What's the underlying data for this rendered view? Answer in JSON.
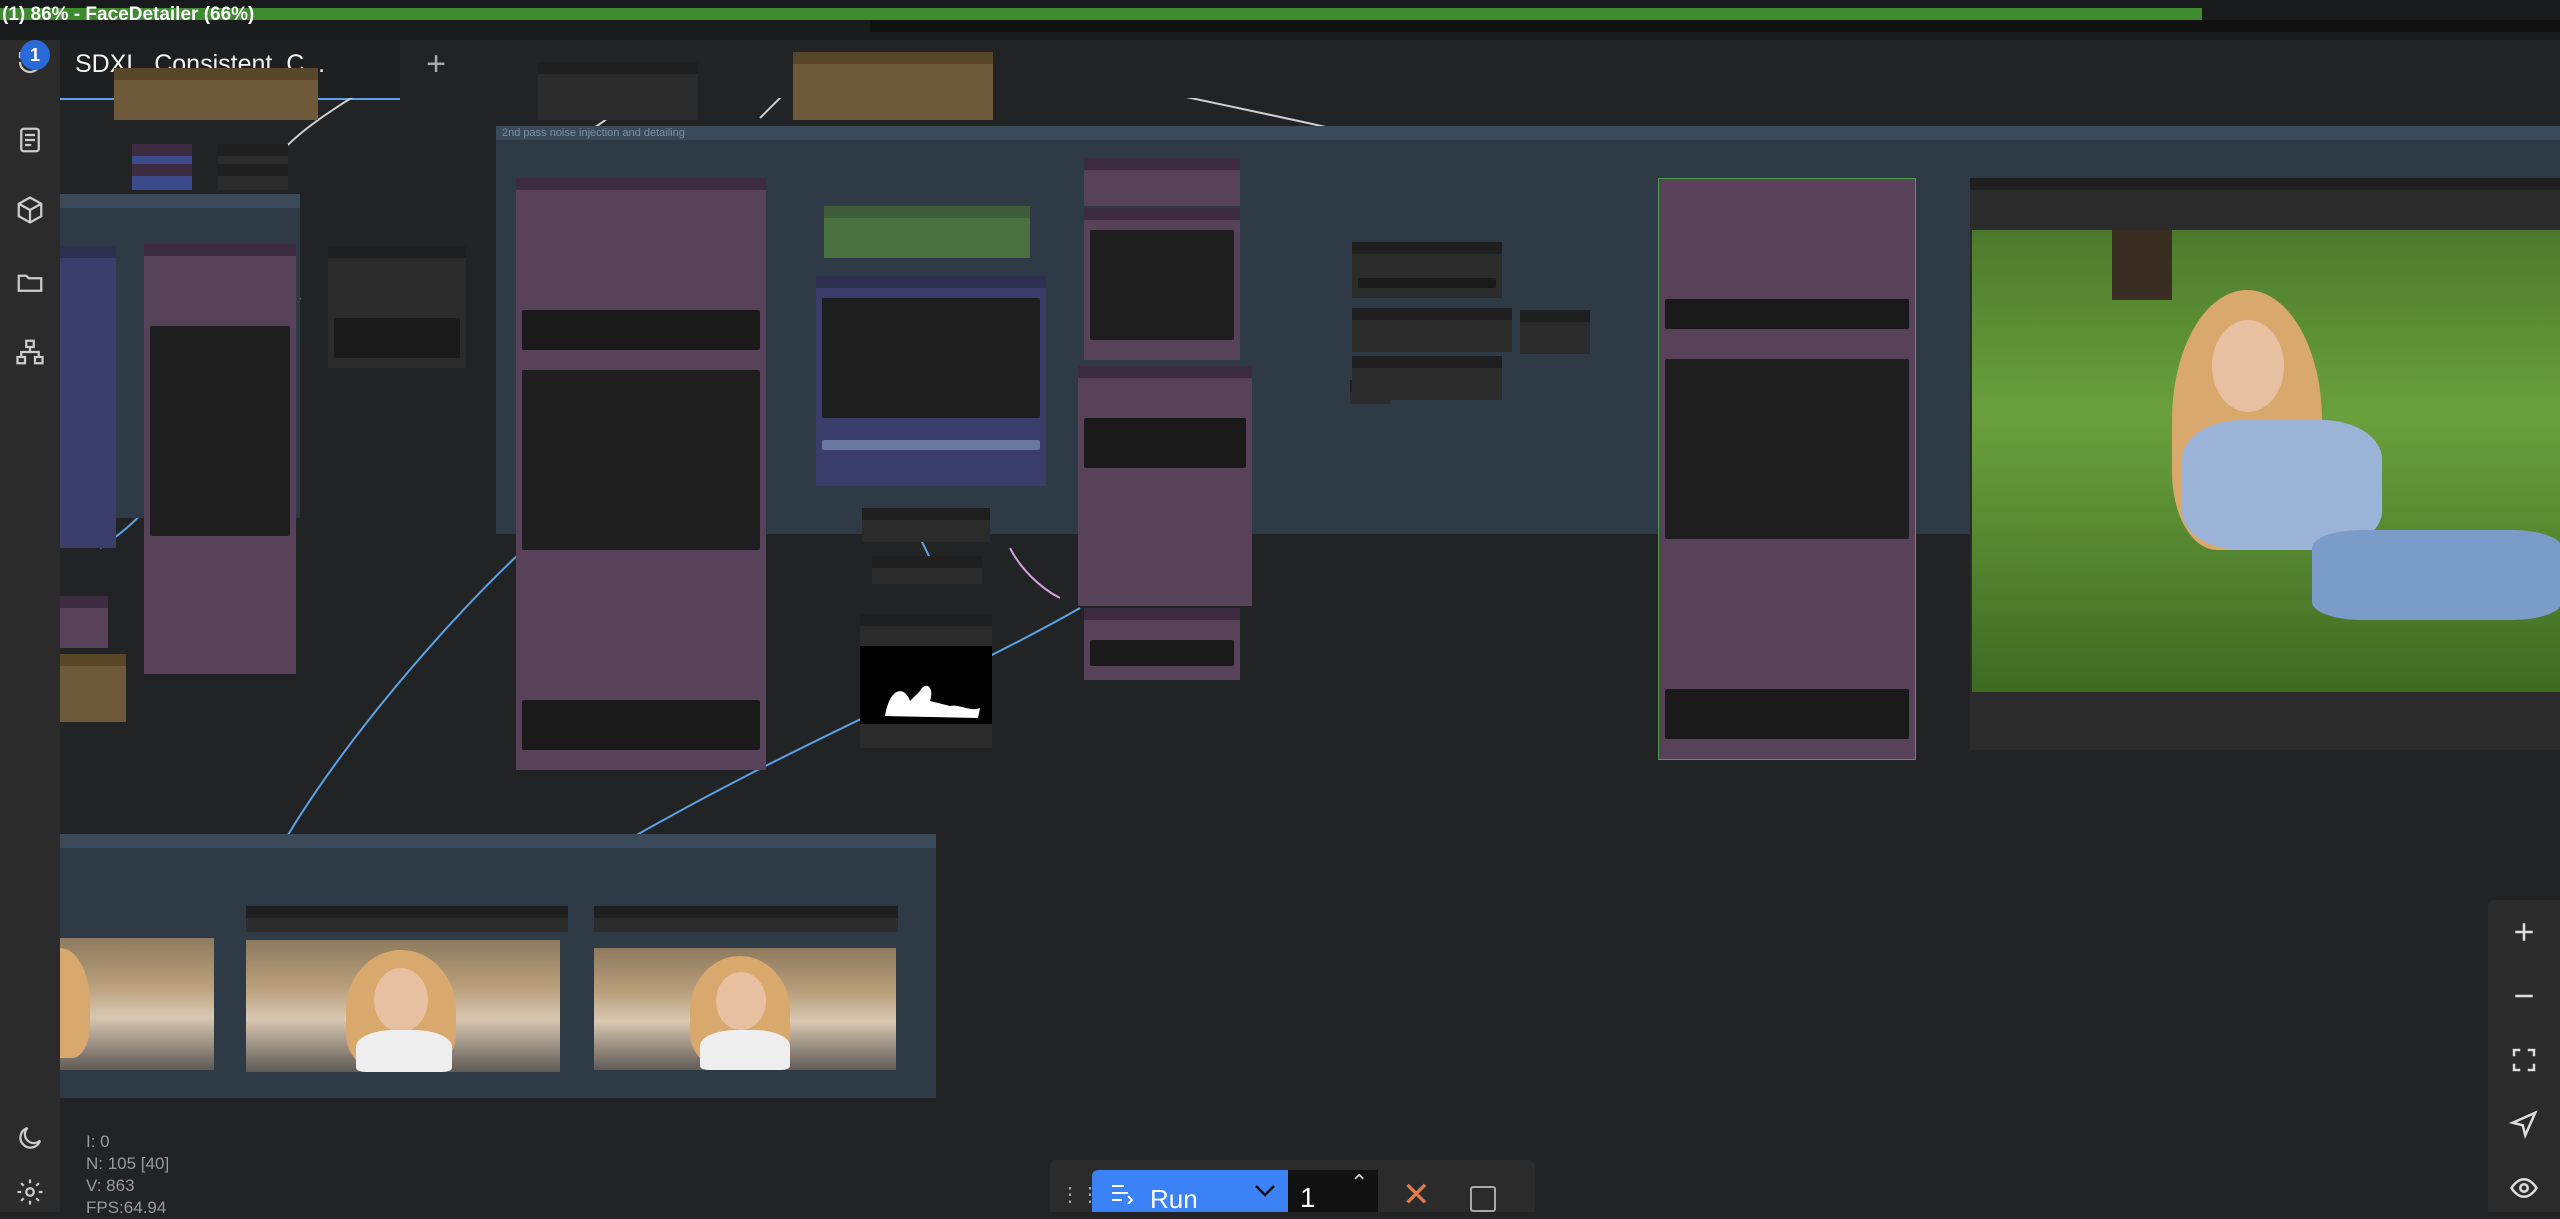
{
  "progress": {
    "label": "(1) 86% - FaceDetailer (66%)",
    "main_percent": 86,
    "sub_percent": 66,
    "main_color": "#3d8b2e"
  },
  "sidebar": {
    "items": [
      {
        "name": "queue-history-icon"
      },
      {
        "name": "node-library-icon"
      },
      {
        "name": "model-library-icon"
      },
      {
        "name": "workflows-icon"
      },
      {
        "name": "templates-icon"
      }
    ],
    "queue_badge": "1",
    "bottom": [
      {
        "name": "theme-toggle-icon"
      },
      {
        "name": "settings-gear-icon"
      }
    ]
  },
  "tabs": {
    "active_label": "SDXL_Consistent_C...",
    "new_tab_symbol": "+"
  },
  "canvas": {
    "group_title": "2nd pass noise injection and detailing"
  },
  "stats": {
    "lines": [
      "I: 0",
      "N: 105 [40]",
      "V: 863",
      "FPS:64.94"
    ]
  },
  "zoom_controls": [
    {
      "name": "zoom-in-icon"
    },
    {
      "name": "zoom-out-icon"
    },
    {
      "name": "fit-view-icon"
    },
    {
      "name": "select-mode-icon"
    },
    {
      "name": "toggle-links-icon"
    }
  ],
  "run_bar": {
    "drag_symbol": "⋮⋮",
    "run_label": "Run",
    "batch_count": "1",
    "cancel_symbol": "✕",
    "accent": "#3b82f6"
  }
}
